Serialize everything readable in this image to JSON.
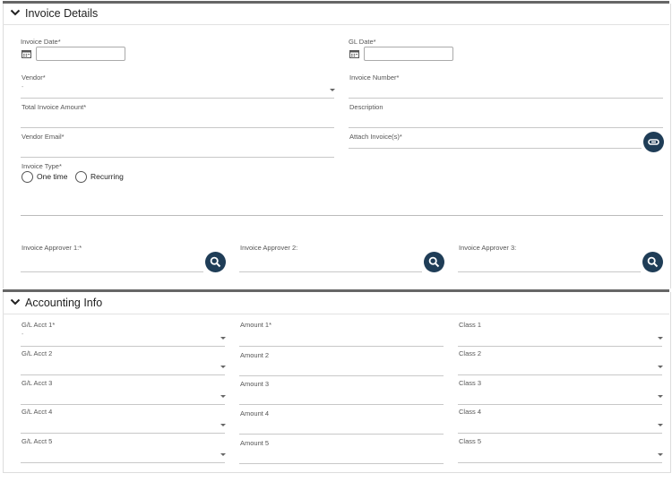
{
  "invoice_details": {
    "header": "Invoice Details",
    "invoice_date_label": "Invoice Date*",
    "gl_date_label": "GL Date*",
    "vendor_label": "Vendor*",
    "vendor_value": "-",
    "invoice_number_label": "Invoice Number*",
    "total_amount_label": "Total Invoice Amount*",
    "description_label": "Description",
    "vendor_email_label": "Vendor Email*",
    "attach_label": "Attach Invoice(s)*",
    "invoice_type_label": "Invoice Type*",
    "invoice_type_options": [
      "One time",
      "Recurring"
    ],
    "approvers": [
      "Invoice Approver 1:*",
      "Invoice Approver 2:",
      "Invoice Approver 3:"
    ]
  },
  "accounting_info": {
    "header": "Accounting Info",
    "gl_accts": [
      "G/L Acct 1*",
      "G/L Acct 2",
      "G/L Acct 3",
      "G/L Acct 4",
      "G/L Acct 5"
    ],
    "gl_first_value": "-",
    "amounts": [
      "Amount 1*",
      "Amount 2",
      "Amount 3",
      "Amount 4",
      "Amount 5"
    ],
    "classes": [
      "Class 1",
      "Class 2",
      "Class 3",
      "Class 4",
      "Class 5"
    ]
  },
  "colors": {
    "accent_button": "#1f3d57",
    "section_bar": "#666666"
  },
  "icons": [
    "chevron-down-icon",
    "calendar-icon",
    "search-icon",
    "paperclip-icon"
  ]
}
